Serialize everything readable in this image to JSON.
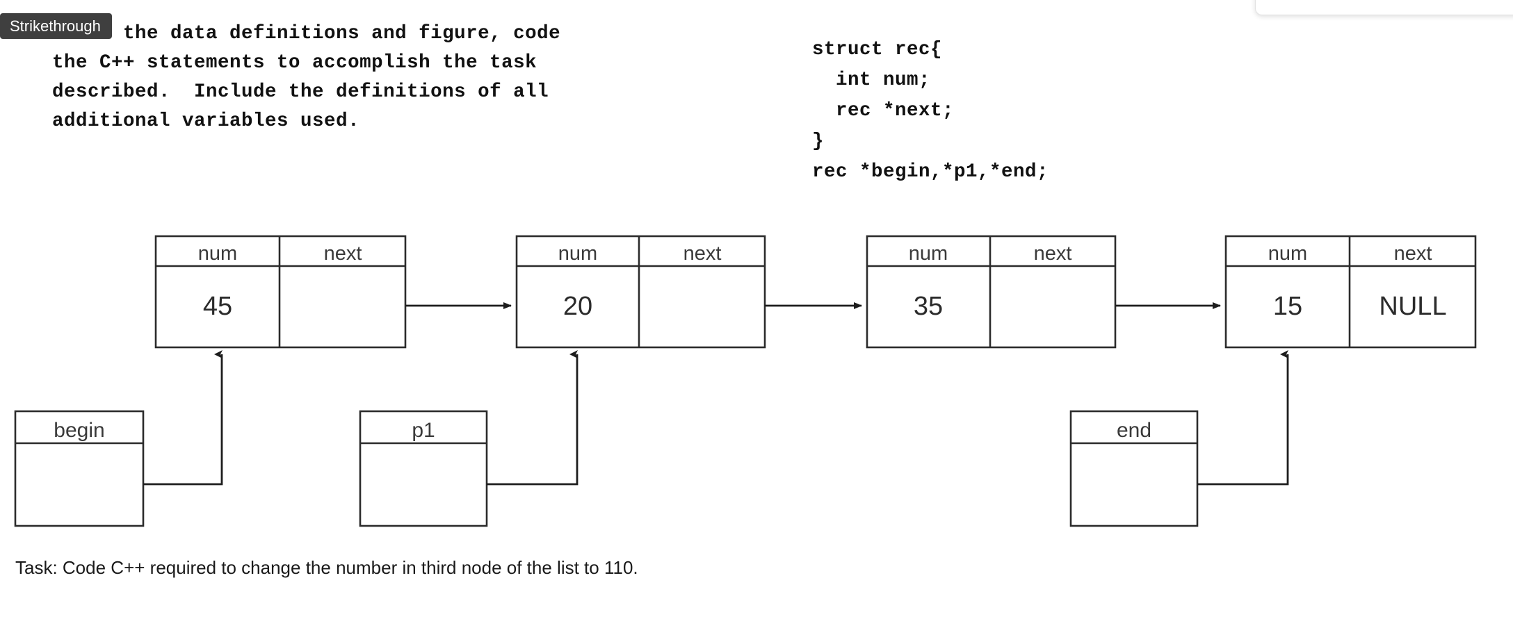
{
  "tooltip": {
    "label": "Strikethrough"
  },
  "question": {
    "line1": "Given the data definitions and figure, code",
    "line2": "the C++ statements to accomplish the task",
    "line3": "described.  Include the definitions of all",
    "line4": "additional variables used."
  },
  "code": {
    "line1": "struct rec{",
    "line2": "  int num;",
    "line3": "  rec *next;",
    "line4": "}",
    "line5": "rec *begin,*p1,*end;"
  },
  "diagram": {
    "header_num": "num",
    "header_next": "next",
    "nodes": [
      {
        "num": "45",
        "next": ""
      },
      {
        "num": "20",
        "next": ""
      },
      {
        "num": "35",
        "next": ""
      },
      {
        "num": "15",
        "next": "NULL"
      }
    ],
    "pointers": [
      {
        "label": "begin",
        "target_node": 1
      },
      {
        "label": "p1",
        "target_node": 2
      },
      {
        "label": "end",
        "target_node": 4
      }
    ]
  },
  "task": {
    "text": "Task: Code C++ required to change the number in third node of the list to 110."
  },
  "colors": {
    "tooltip_bg": "#3f3f3f",
    "tooltip_fg": "#ffffff",
    "stroke": "#2b2b2b",
    "text": "#3a3a3a",
    "page_bg": "#ffffff"
  }
}
